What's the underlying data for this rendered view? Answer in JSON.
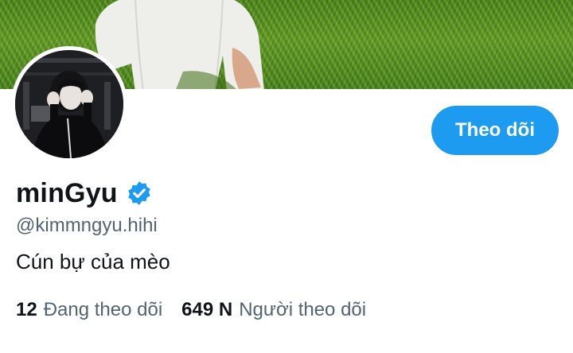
{
  "profile": {
    "display_name": "minGyu",
    "handle": "@kimmngyu.hihi",
    "bio": "Cún bự của mèo",
    "verified_icon": "verified-badge-icon"
  },
  "actions": {
    "follow_label": "Theo dõi"
  },
  "stats": {
    "following_count": "12",
    "following_label": "Đang theo dõi",
    "followers_count": "649 N",
    "followers_label": "Người theo dõi"
  },
  "colors": {
    "accent": "#1d9bf0",
    "text_primary": "#0f1419",
    "text_secondary": "#536471"
  }
}
